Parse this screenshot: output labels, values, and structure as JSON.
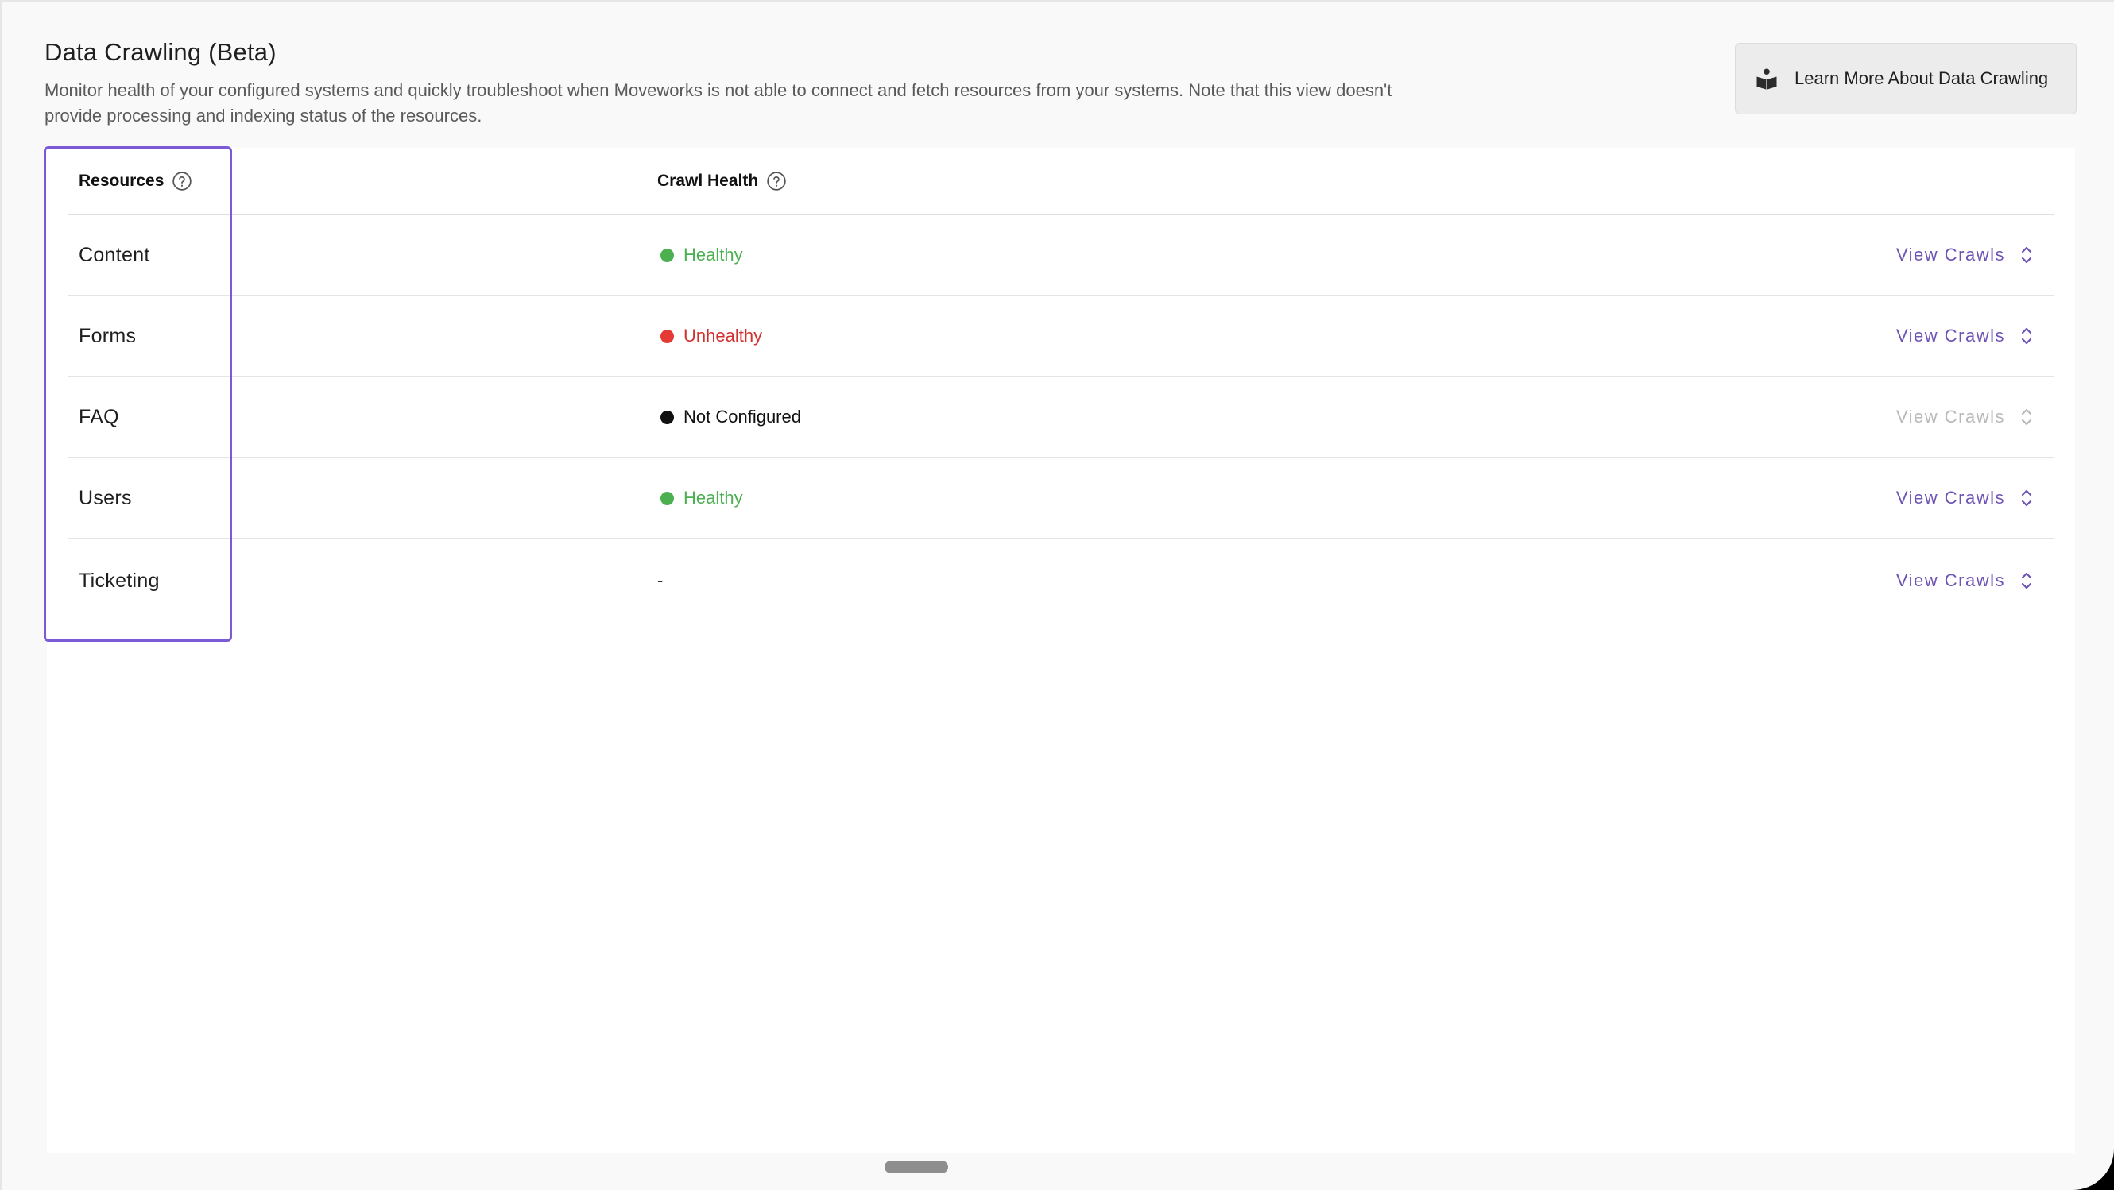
{
  "page": {
    "title": "Data Crawling (Beta)",
    "description": "Monitor health of your configured systems and quickly troubleshoot when Moveworks is not able to connect and fetch resources from your systems. Note that this view doesn't provide processing and indexing status of the resources."
  },
  "learn_button": {
    "label": "Learn More About Data Crawling",
    "icon": "book-reader-icon"
  },
  "table": {
    "headers": {
      "resources": "Resources",
      "crawl_health": "Crawl Health"
    },
    "rows": [
      {
        "resource": "Content",
        "status": "Healthy",
        "status_color": "#4caf50",
        "text_color": "#4caf50",
        "action": "View Crawls",
        "action_color": "#6e54b5",
        "action_enabled": true
      },
      {
        "resource": "Forms",
        "status": "Unhealthy",
        "status_color": "#e53935",
        "text_color": "#d32f2f",
        "action": "View Crawls",
        "action_color": "#6e54b5",
        "action_enabled": true
      },
      {
        "resource": "FAQ",
        "status": "Not Configured",
        "status_color": "#111111",
        "text_color": "#111111",
        "action": "View Crawls",
        "action_color": "#b9b9b9",
        "action_enabled": false
      },
      {
        "resource": "Users",
        "status": "Healthy",
        "status_color": "#4caf50",
        "text_color": "#4caf50",
        "action": "View Crawls",
        "action_color": "#6e54b5",
        "action_enabled": true
      },
      {
        "resource": "Ticketing",
        "status": "-",
        "status_color": "",
        "text_color": "#333333",
        "action": "View Crawls",
        "action_color": "#6e54b5",
        "action_enabled": true
      }
    ]
  },
  "colors": {
    "accent": "#6e54b5",
    "highlight": "#7b5ad6"
  }
}
